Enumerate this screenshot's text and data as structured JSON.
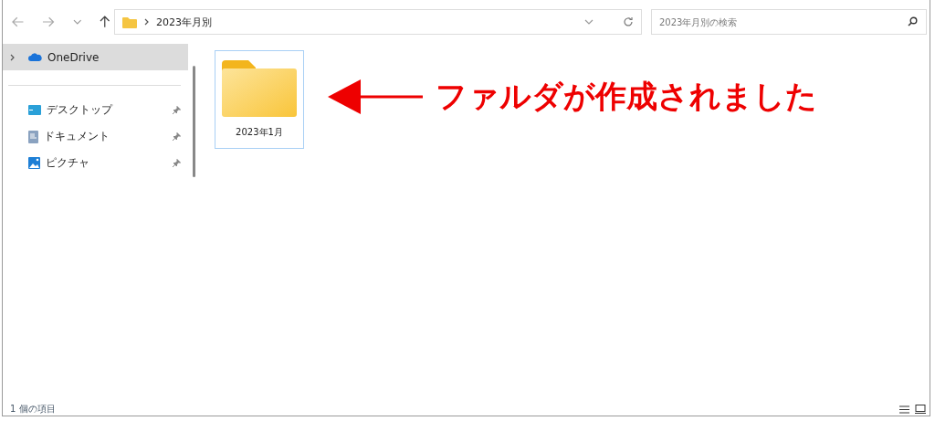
{
  "toolbar": {
    "path": [
      "2023年月別"
    ],
    "search": {
      "placeholder": "2023年月別の検索"
    }
  },
  "sidebar": {
    "items": [
      {
        "label": "OneDrive",
        "kind": "cloud",
        "selected": true,
        "expanded": false,
        "pinned": false
      },
      {
        "label": "デスクトップ",
        "kind": "desktop",
        "selected": false,
        "pinned": true
      },
      {
        "label": "ドキュメント",
        "kind": "document",
        "selected": false,
        "pinned": true
      },
      {
        "label": "ピクチャ",
        "kind": "picture",
        "selected": false,
        "pinned": true
      }
    ]
  },
  "content": {
    "items": [
      {
        "name": "2023年1月",
        "selected": true
      }
    ]
  },
  "annotation": {
    "text": "ファルダが作成されました"
  },
  "status_bar": {
    "text": "1 個の項目"
  }
}
